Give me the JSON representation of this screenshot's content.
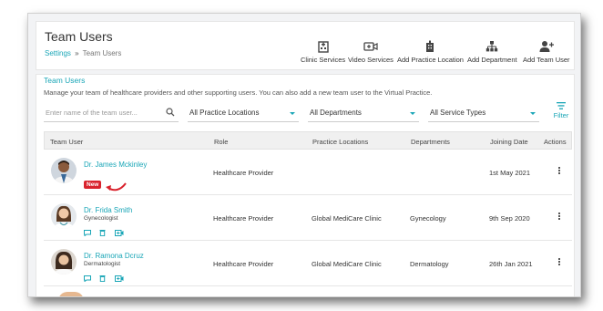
{
  "header": {
    "title": "Team Users",
    "breadcrumb": {
      "settings": "Settings",
      "separator": "»",
      "current": "Team Users"
    },
    "actions": [
      {
        "label": "Clinic Services",
        "icon": "hospital-icon"
      },
      {
        "label": "Video Services",
        "icon": "video-plus-icon"
      },
      {
        "label": "Add Practice Location",
        "icon": "building-add-icon"
      },
      {
        "label": "Add Department",
        "icon": "sitemap-icon"
      },
      {
        "label": "Add Team User",
        "icon": "user-add-icon"
      }
    ]
  },
  "section": {
    "title": "Team Users",
    "description": "Manage your team of healthcare providers and other supporting users. You can also add a new team user to the Virtual Practice."
  },
  "filters": {
    "search_placeholder": "Enter name of the team user...",
    "locations": "All Practice Locations",
    "departments": "All Departments",
    "service_types": "All Service Types",
    "filter_label": "Filter"
  },
  "table": {
    "headers": {
      "user": "Team User",
      "role": "Role",
      "locations": "Practice Locations",
      "departments": "Departments",
      "joining": "Joining Date",
      "actions": "Actions"
    },
    "rows": [
      {
        "name": "Dr. James Mckinley",
        "specialty": "",
        "badge": "New",
        "role": "Healthcare Provider",
        "location": "",
        "department": "",
        "joined": "1st May 2021"
      },
      {
        "name": "Dr. Frida Smith",
        "specialty": "Gynecologist",
        "badge": "",
        "role": "Healthcare Provider",
        "location": "Global MediCare Clinic",
        "department": "Gynecology",
        "joined": "9th Sep 2020"
      },
      {
        "name": "Dr. Ramona Dcruz",
        "specialty": "Dermatologist",
        "badge": "",
        "role": "Healthcare Provider",
        "location": "Global MediCare Clinic",
        "department": "Dermatology",
        "joined": "26th Jan 2021"
      }
    ]
  },
  "colors": {
    "accent": "#1aa6b7",
    "badge": "#d9232d",
    "arrow": "#d9232d"
  }
}
